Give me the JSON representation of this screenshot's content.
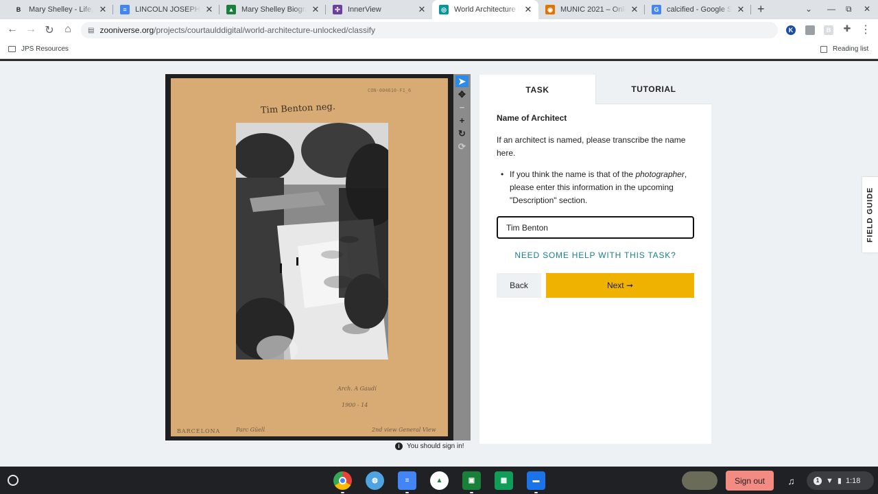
{
  "browser": {
    "tabs": [
      {
        "title": "Mary Shelley - Life, Fra",
        "favicon_letter": "B",
        "favicon_color": "#ffffff"
      },
      {
        "title": "LINCOLN JOSEPH - M",
        "favicon_letter": "≡",
        "favicon_color": "#4285f4"
      },
      {
        "title": "Mary Shelley Biograph",
        "favicon_letter": "▲",
        "favicon_color": "#188038"
      },
      {
        "title": "InnerView",
        "favicon_letter": "✣",
        "favicon_color": "#6b3fa0"
      },
      {
        "title": "World Architecture Un",
        "favicon_letter": "◎",
        "favicon_color": "#00979d"
      },
      {
        "title": "MUNIC 2021 – Online",
        "favicon_letter": "◉",
        "favicon_color": "#e37400"
      },
      {
        "title": "calcified - Google Sea",
        "favicon_letter": "G",
        "favicon_color": "#4285f4"
      }
    ],
    "active_tab_index": 4,
    "new_tab": "+",
    "url_host": "zooniverse.org",
    "url_path": "/projects/courtaulddigital/world-architecture-unlocked/classify",
    "bookmarks": [
      {
        "label": "JPS Resources"
      }
    ],
    "reading_list": "Reading list",
    "extension_k": "K",
    "extension_b": "B"
  },
  "subject": {
    "neg_id": "CON-004610-F1_6",
    "caption": "Tim Benton neg.",
    "note_arch": "Arch.    A  Gaudí",
    "note_year": "1900 - 14",
    "note_place": "BARCELONA",
    "note_park": "Parc Güell",
    "note_view": "2nd view   General View"
  },
  "viewer_tools": {
    "select": "➤",
    "move": "✥",
    "zoom_out": "−",
    "zoom_in": "+",
    "rotate": "↻",
    "reset": "⟳"
  },
  "signin_notice": "You should sign in!",
  "signin_icon": "i",
  "task_panel": {
    "tabs": {
      "task": "TASK",
      "tutorial": "TUTORIAL"
    },
    "title": "Name of Architect",
    "instruction": "If an architect is named, please transcribe the name here.",
    "bullet_before": "If you think the name is that of the ",
    "bullet_em": "photographer",
    "bullet_after": ", please enter this information in the upcoming \"Description\" section.",
    "answer_value": "Tim Benton",
    "help_link": "NEED SOME HELP WITH THIS TASK?",
    "back_label": "Back",
    "next_label": "Next ➞"
  },
  "field_guide": "FIELD GUIDE",
  "shelf": {
    "sign_out": "Sign out",
    "notification_count": "1",
    "time": "1:18"
  },
  "colors": {
    "accent_next": "#f0b200",
    "help_link": "#1a7f8e",
    "tool_active": "#2c8be8",
    "card": "#d9ab74",
    "sign_out": "#f28b82"
  }
}
